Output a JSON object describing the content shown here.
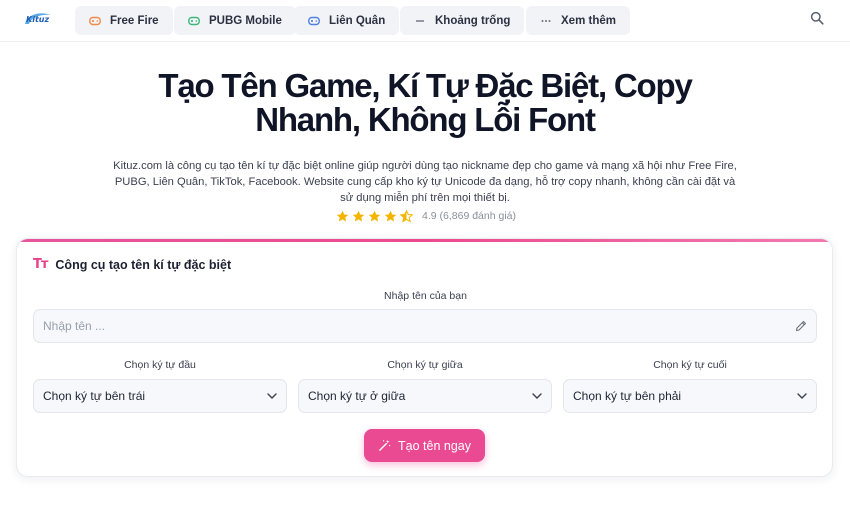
{
  "header": {
    "logo_text": "Kituz",
    "nav": [
      {
        "label": "Free Fire",
        "icon": "gamepad-icon",
        "color": "#f08a4b"
      },
      {
        "label": "PUBG Mobile",
        "icon": "gamepad-icon",
        "color": "#3cb878"
      },
      {
        "label": "Liên Quân",
        "icon": "gamepad-icon",
        "color": "#4f7fe0"
      },
      {
        "label": "Khoảng trống",
        "icon": "minus-icon",
        "color": "#6b7080"
      },
      {
        "label": "Xem thêm",
        "icon": "more-icon",
        "color": "#6b7080"
      }
    ]
  },
  "hero": {
    "title_line1": "Tạo Tên Game, Kí Tự Đặc Biệt, Copy",
    "title_line2": "Nhanh, Không Lỗi Font",
    "description": "Kituz.com là công cụ tạo tên kí tự đặc biệt online giúp người dùng tạo nickname đẹp cho game và mạng xã hội như Free Fire, PUBG, Liên Quân, TikTok, Facebook. Website cung cấp kho ký tự Unicode đa dạng, hỗ trợ copy nhanh, không cần cài đặt và sử dụng miễn phí trên mọi thiết bị.",
    "rating_value": 4.5,
    "rating_text": "4.9 (6,869 đánh giá)"
  },
  "tool": {
    "title_icon": "Tт",
    "title": "Công cụ tạo tên kí tự đặc biệt",
    "input_label": "Nhập tên của bạn",
    "input_placeholder": "Nhập tên ...",
    "input_value": "",
    "selects": [
      {
        "label": "Chọn ký tự đầu",
        "value": "Chọn ký tự bên trái"
      },
      {
        "label": "Chọn ký tự giữa",
        "value": "Chọn ký tự ở giữa"
      },
      {
        "label": "Chọn ký tự cuối",
        "value": "Chọn ký tự bên phải"
      }
    ],
    "submit_label": "Tạo tên ngay"
  },
  "colors": {
    "accent": "#ea4a92",
    "star": "#f5b400",
    "nav_bg": "#f1f3f7"
  }
}
